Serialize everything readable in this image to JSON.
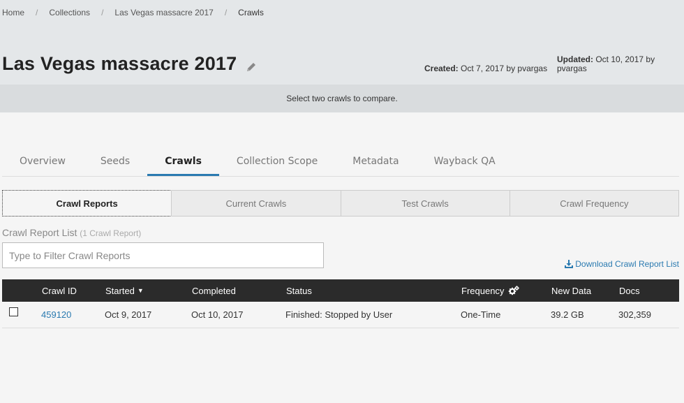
{
  "breadcrumb": {
    "items": [
      "Home",
      "Collections",
      "Las Vegas massacre 2017",
      "Crawls"
    ],
    "separator": "/"
  },
  "collection": {
    "title": "Las Vegas massacre 2017",
    "created_label": "Created:",
    "created_value": "Oct 7, 2017 by pvargas",
    "updated_label": "Updated:",
    "updated_value": "Oct 10, 2017 by pvargas"
  },
  "compare_message": "Select two crawls to compare.",
  "tabs": [
    {
      "label": "Overview",
      "active": false
    },
    {
      "label": "Seeds",
      "active": false
    },
    {
      "label": "Crawls",
      "active": true
    },
    {
      "label": "Collection Scope",
      "active": false
    },
    {
      "label": "Metadata",
      "active": false
    },
    {
      "label": "Wayback QA",
      "active": false
    }
  ],
  "subtabs": [
    {
      "label": "Crawl Reports",
      "active": true
    },
    {
      "label": "Current Crawls",
      "active": false
    },
    {
      "label": "Test Crawls",
      "active": false
    },
    {
      "label": "Crawl Frequency",
      "active": false
    }
  ],
  "report_list": {
    "heading": "Crawl Report List",
    "count_text": "(1 Crawl Report)",
    "filter_placeholder": "Type to Filter Crawl Reports",
    "download_label": "Download Crawl Report List"
  },
  "table": {
    "columns": [
      "Crawl ID",
      "Started",
      "Completed",
      "Status",
      "Frequency",
      "New Data",
      "Docs"
    ],
    "rows": [
      {
        "crawl_id": "459120",
        "started": "Oct 9, 2017",
        "completed": "Oct 10, 2017",
        "status": "Finished: Stopped by User",
        "frequency": "One-Time",
        "new_data": "39.2 GB",
        "docs": "302,359"
      }
    ]
  },
  "colors": {
    "accent": "#2a7ab0",
    "header_band": "#e4e7e9",
    "table_header": "#2b2b2b"
  }
}
